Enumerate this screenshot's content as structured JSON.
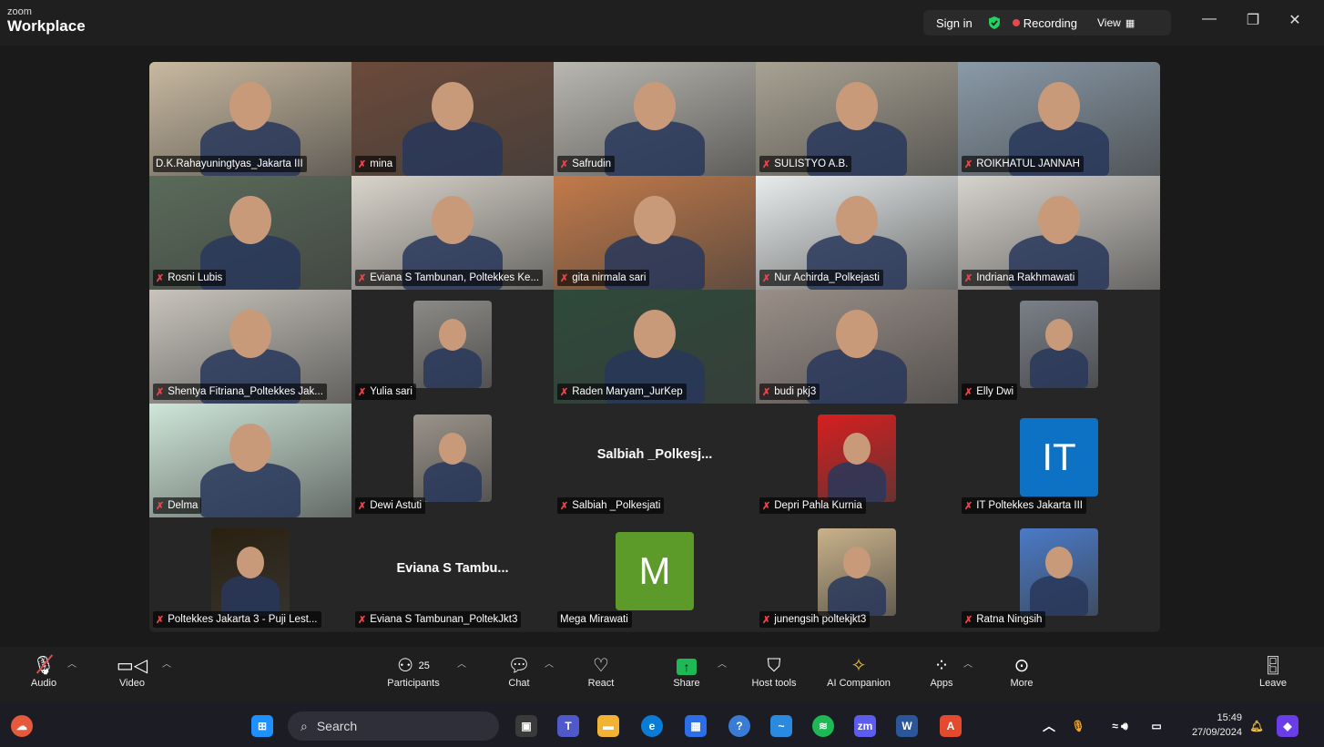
{
  "app": {
    "logo_small": "zoom",
    "logo_big": "Workplace"
  },
  "topbar": {
    "sign_in": "Sign in",
    "recording": "Recording",
    "view": "View",
    "recording_color": "#e5484d"
  },
  "participants": [
    {
      "name": "D.K.Rahayuningtyas_Jakarta III",
      "muted": false,
      "video": true,
      "bg": "#c8b9a0",
      "active": true
    },
    {
      "name": "mina",
      "muted": true,
      "video": true,
      "bg": "#6b4a3a"
    },
    {
      "name": "Safrudin",
      "muted": true,
      "video": true,
      "bg": "#b9b7b0"
    },
    {
      "name": "SULISTYO A.B.",
      "muted": true,
      "video": true,
      "bg": "#a8a293"
    },
    {
      "name": "ROIKHATUL JANNAH",
      "muted": true,
      "video": true,
      "bg": "#8a9aa8"
    },
    {
      "name": "Rosni Lubis",
      "muted": true,
      "video": true,
      "bg": "#5a6b5a"
    },
    {
      "name": "Eviana S Tambunan, Poltekkes Ke...",
      "muted": true,
      "video": true,
      "bg": "#d9d4cb"
    },
    {
      "name": "gita nirmala sari",
      "muted": true,
      "video": true,
      "bg": "#c27a4a"
    },
    {
      "name": "Nur Achirda_Polkejasti",
      "muted": true,
      "video": true,
      "bg": "#e8ecec"
    },
    {
      "name": "Indriana Rakhmawati",
      "muted": true,
      "video": true,
      "bg": "#d6d2cc"
    },
    {
      "name": "Shentya Fitriana_Poltekkes Jak...",
      "muted": true,
      "video": true,
      "bg": "#c8c4bc"
    },
    {
      "name": "Yulia sari",
      "muted": true,
      "video": true,
      "bg": "#8c8a86",
      "inset": true
    },
    {
      "name": "Raden Maryam_JurKep",
      "muted": true,
      "video": true,
      "bg": "#2d4a3a"
    },
    {
      "name": "budi pkj3",
      "muted": true,
      "video": true,
      "bg": "#9a8f88"
    },
    {
      "name": "Elly Dwi",
      "muted": true,
      "video": true,
      "bg": "#7a8088",
      "inset": true
    },
    {
      "name": "Delma",
      "muted": true,
      "video": true,
      "bg": "#cfe6d9"
    },
    {
      "name": "Dewi Astuti",
      "muted": true,
      "video": true,
      "bg": "#9a938a",
      "inset": true
    },
    {
      "name": "Salbiah _Polkesjati",
      "muted": true,
      "video": false,
      "display": "Salbiah _Polkesj..."
    },
    {
      "name": "Depri Pahla Kurnia",
      "muted": true,
      "video": true,
      "bg": "#d61f1f",
      "inset": true
    },
    {
      "name": "IT Poltekkes Jakarta III",
      "muted": true,
      "video": false,
      "avatar": "IT",
      "avatar_color": "#0e72c4"
    },
    {
      "name": "Poltekkes Jakarta 3 - Puji Lest...",
      "muted": true,
      "video": true,
      "bg": "#2a2010",
      "inset": true
    },
    {
      "name": "Eviana S Tambunan_PoltekJkt3",
      "muted": true,
      "video": false,
      "display": "Eviana S Tambu..."
    },
    {
      "name": "Mega Mirawati",
      "muted": false,
      "video": false,
      "avatar": "M",
      "avatar_color": "#5c9a2a"
    },
    {
      "name": "junengsih poltekjkt3",
      "muted": true,
      "video": true,
      "bg": "#c9b28a",
      "inset": true
    },
    {
      "name": "Ratna Ningsih",
      "muted": true,
      "video": true,
      "bg": "#4a7ac8",
      "inset": true
    }
  ],
  "toolbar": {
    "audio": "Audio",
    "video": "Video",
    "participants": "Participants",
    "participant_count": "25",
    "chat": "Chat",
    "react": "React",
    "share": "Share",
    "host_tools": "Host tools",
    "ai_companion": "AI Companion",
    "apps": "Apps",
    "more": "More",
    "leave": "Leave"
  },
  "taskbar": {
    "search": "Search",
    "time": "15:49",
    "date": "27/09/2024"
  }
}
